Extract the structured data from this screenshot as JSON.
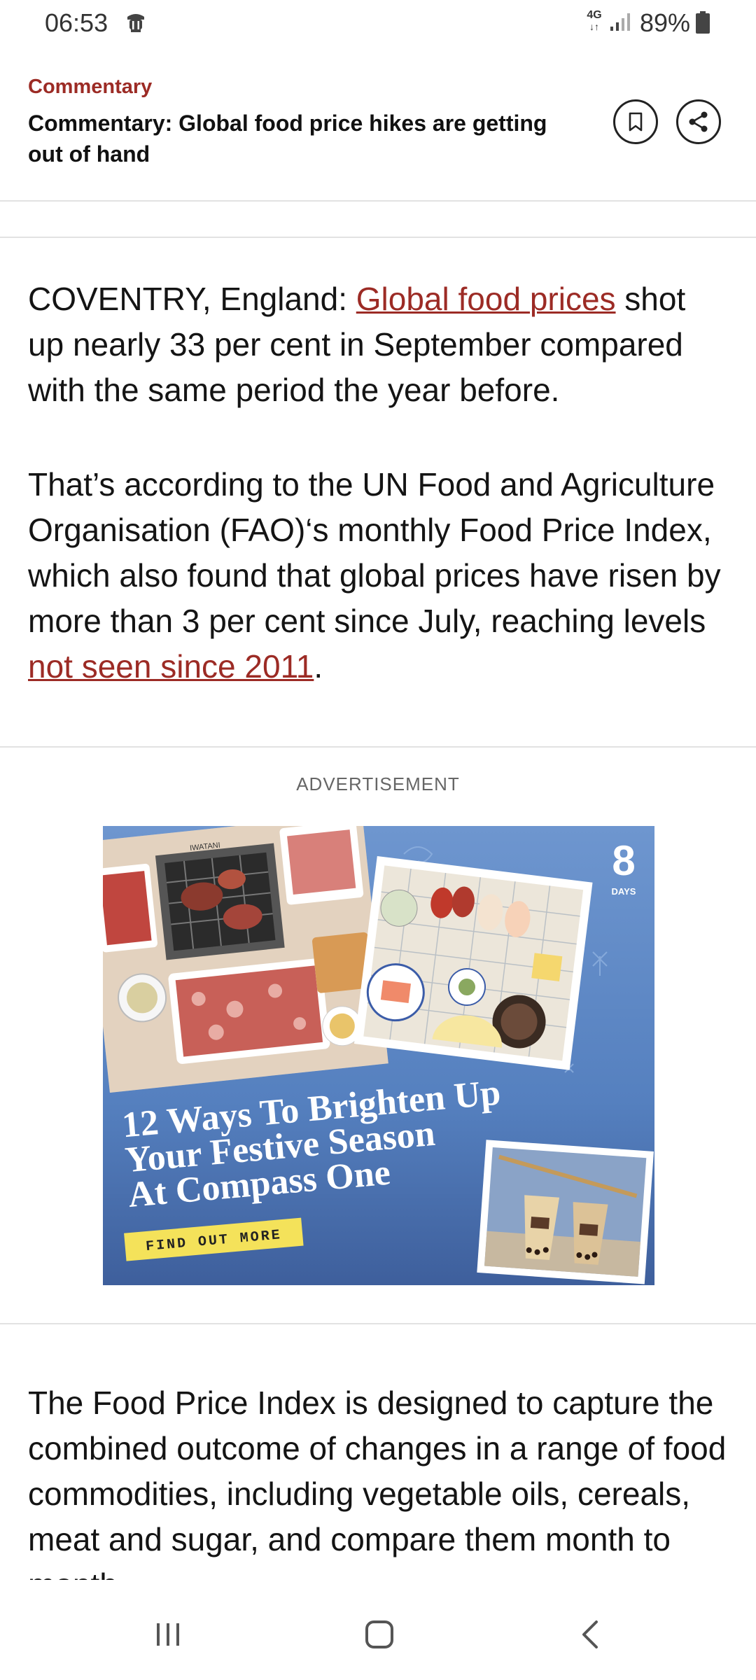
{
  "status_bar": {
    "time": "06:53",
    "network": "4G",
    "battery": "89%",
    "icons": [
      "notification-app-icon",
      "signal-icon",
      "battery-icon"
    ]
  },
  "header": {
    "section": "Commentary",
    "title": "Commentary: Global food price hikes are getting out of hand",
    "icons": [
      "bookmark-icon",
      "share-icon"
    ]
  },
  "article": {
    "p1_prefix": "COVENTRY, England: ",
    "p1_link": "Global food prices",
    "p1_suffix": " shot up nearly 33 per cent in September compared with the same period the year before.",
    "p2_prefix": "That’s according to the UN Food and Agriculture Organisation (FAO)‘s monthly Food Price Index, which also found that global prices have risen by more than 3 per cent since July, reaching levels ",
    "p2_link": "not seen since 2011",
    "p2_suffix": ".",
    "p3": "The Food Price Index is designed to capture the combined outcome of changes in a range of food commodities, including vegetable oils, cereals, meat and sugar, and compare them month to month."
  },
  "advertisement": {
    "label": "ADVERTISEMENT",
    "headline_line1": "12 Ways To Brighten Up",
    "headline_line2": "Your Festive Season",
    "headline_line3": "At Compass One",
    "cta": "FIND OUT MORE",
    "brand_number": "8",
    "brand_word": "DAYS",
    "grill_brand": "IWATANI",
    "colors": {
      "background": "#5b86c4",
      "cta_bg": "#f4e25a"
    }
  },
  "nav_bar": {
    "icons": [
      "recents-icon",
      "home-icon",
      "back-icon"
    ]
  },
  "theme": {
    "accent": "#9c2b25",
    "divider": "#e2e2e2"
  }
}
